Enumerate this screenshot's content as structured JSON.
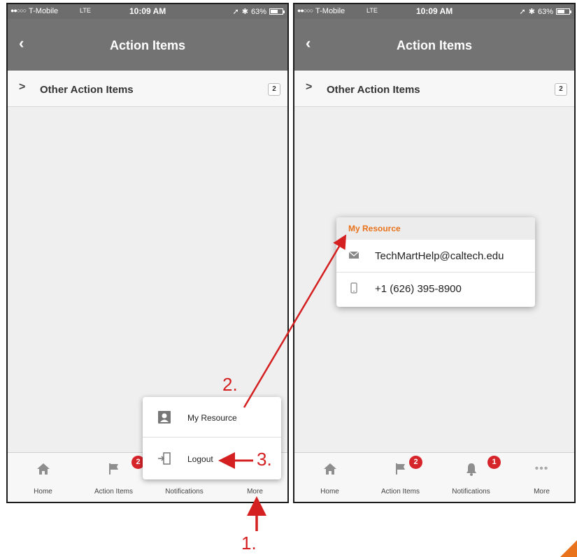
{
  "status_bar": {
    "carrier": "T-Mobile",
    "network": "LTE",
    "time": "10:09 AM",
    "battery": "63%"
  },
  "nav": {
    "title": "Action Items"
  },
  "list": {
    "row_label": "Other Action Items",
    "row_count": "2"
  },
  "tabs": {
    "home": "Home",
    "action_items": "Action Items",
    "notifications": "Notifications",
    "more": "More",
    "action_items_badge": "2",
    "notifications_badge": "1"
  },
  "more_menu": {
    "my_resource": "My Resource",
    "logout": "Logout"
  },
  "resource_card": {
    "header": "My Resource",
    "email": "TechMartHelp@caltech.edu",
    "phone": "+1 (626) 395-8900"
  },
  "annotations": {
    "step1": "1.",
    "step2": "2.",
    "step3": "3."
  },
  "colors": {
    "header_gray": "#737373",
    "badge_red": "#d6242b",
    "accent_orange": "#e8731c",
    "annotation_red": "#d42020"
  }
}
